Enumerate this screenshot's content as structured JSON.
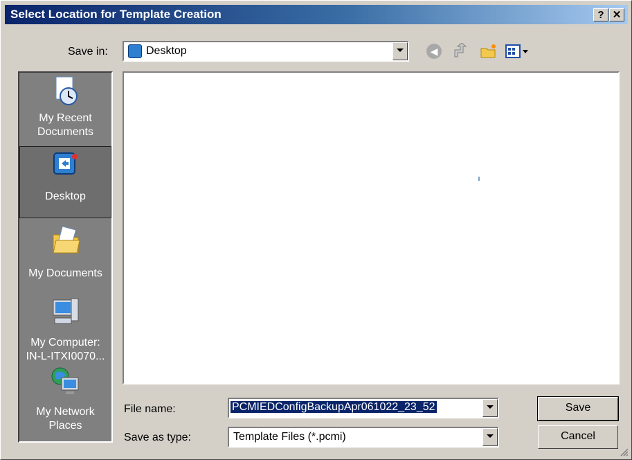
{
  "window": {
    "title": "Select Location for Template Creation",
    "help_label": "?",
    "close_label": "✕"
  },
  "save_in": {
    "label": "Save in:",
    "value": "Desktop"
  },
  "toolbar": {
    "back_icon": "back-arrow-icon",
    "up_icon": "up-folder-icon",
    "new_folder_icon": "new-folder-icon",
    "views_icon": "views-menu-icon"
  },
  "places": [
    {
      "line1": "My Recent",
      "line2": "Documents"
    },
    {
      "line1": "Desktop",
      "line2": ""
    },
    {
      "line1": "My Documents",
      "line2": ""
    },
    {
      "line1": "My Computer:",
      "line2": "IN-L-ITXI0070..."
    },
    {
      "line1": "My Network",
      "line2": "Places"
    }
  ],
  "file_name": {
    "label": "File name:",
    "value": "PCMIEDConfigBackupApr061022_23_52"
  },
  "save_as_type": {
    "label": "Save as type:",
    "value": "Template Files (*.pcmi)"
  },
  "buttons": {
    "save": "Save",
    "cancel": "Cancel"
  },
  "colors": {
    "titlebar_start": "#0a246a",
    "titlebar_end": "#a6caf0",
    "selection": "#0a246a"
  }
}
